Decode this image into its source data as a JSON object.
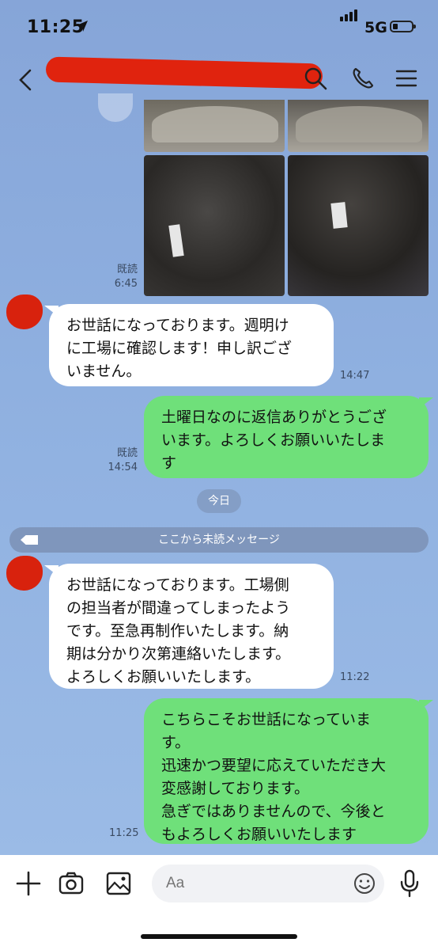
{
  "status_bar": {
    "time": "11:25",
    "network": "5G",
    "battery_level": 0.2
  },
  "chat": {
    "messages": [
      {
        "id": "m-photos",
        "direction": "out",
        "type": "photos",
        "read": "既読",
        "time": "6:45"
      },
      {
        "id": "m1",
        "direction": "in",
        "lines": [
          "お世話になっております。週明け",
          "に工場に確認します！申し訳ござ",
          "いません。"
        ],
        "time": "14:47"
      },
      {
        "id": "m2",
        "direction": "out",
        "lines": [
          "土曜日なのに返信ありがとうござ",
          "います。よろしくお願いいたしま",
          "す"
        ],
        "read": "既読",
        "time": "14:54"
      },
      {
        "id": "m3",
        "direction": "in",
        "lines": [
          "お世話になっております。工場側",
          "の担当者が間違ってしまったよう",
          "です。至急再制作いたします。納",
          "期は分かり次第連絡いたします。",
          "よろしくお願いいたします。"
        ],
        "time": "11:22"
      },
      {
        "id": "m4",
        "direction": "out",
        "lines": [
          "こちらこそお世話になっていま",
          "す。",
          "迅速かつ要望に応えていただき大",
          "変感謝しております。",
          "急ぎではありませんので、今後と",
          "もよろしくお願いいたします"
        ],
        "time": "11:25"
      }
    ],
    "date_divider": "今日",
    "unread_divider": "ここから未読メッセージ"
  },
  "input": {
    "placeholder": "Aa"
  },
  "colors": {
    "chat_bg": "#8aa8d8",
    "outgoing_bubble": "#6fe07a",
    "incoming_bubble": "#ffffff",
    "redaction": "#e0230e"
  }
}
